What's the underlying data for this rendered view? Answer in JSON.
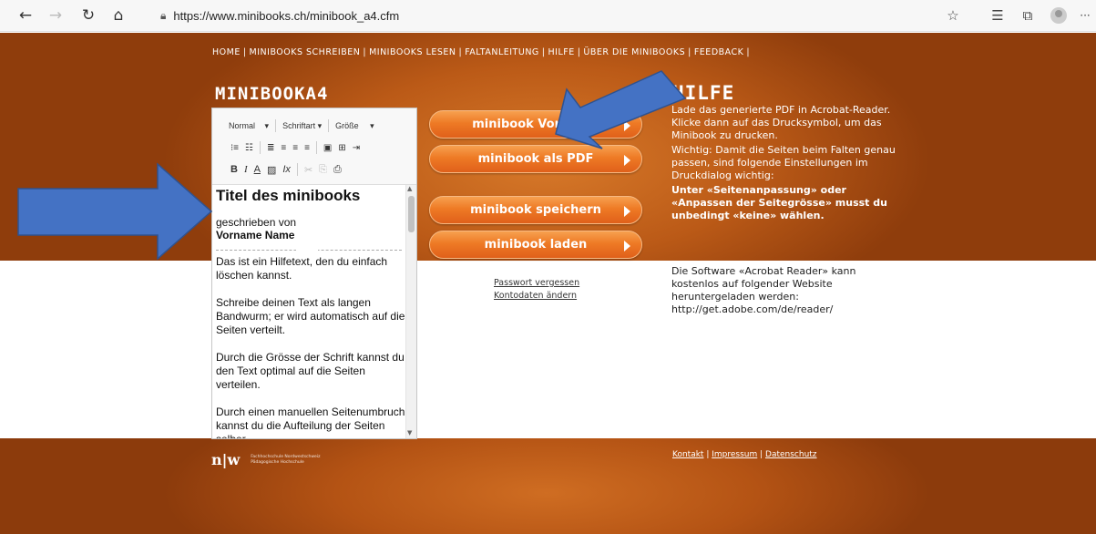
{
  "browser": {
    "url": "https://www.minibooks.ch/minibook_a4.cfm",
    "buttons": {
      "back": "←",
      "forward": "→",
      "refresh": "↻",
      "home": "⌂",
      "lock": "🔒",
      "favorite": "☆",
      "favorites": "☰",
      "collections": "⧉",
      "more": "···"
    }
  },
  "nav": {
    "items": [
      "HOME",
      "MINIBOOKS SCHREIBEN",
      "MINIBOOKS LESEN",
      "FALTANLEITUNG",
      "HILFE",
      "ÜBER DIE MINIBOOKS",
      "FEEDBACK"
    ]
  },
  "headings": {
    "minibook": "MINIBOOKA4",
    "hilfe": "HILFE"
  },
  "editor": {
    "toolbar": {
      "format": "Normal",
      "font": "Schriftart",
      "size": "Größe",
      "dropdown_caret": "▾",
      "row2": [
        "⁝≡",
        "☷",
        "≣",
        "≡",
        "≡",
        "≡",
        "▣",
        "⊞",
        "⇥"
      ],
      "row3": [
        "B",
        "I",
        "A",
        "▨",
        "Ix",
        "✂",
        "⎘",
        "⎙"
      ]
    },
    "title": "Titel des minibooks",
    "written_by": "geschrieben von",
    "name": "Vorname Name",
    "paragraphs": [
      "Das ist ein Hilfetext, den du einfach löschen kannst.",
      "Schreibe deinen Text als langen Bandwurm; er wird automatisch auf die Seiten verteilt.",
      "Durch die Grösse der Schrift kannst du den Text optimal auf die Seiten verteilen.",
      "Durch einen manuellen Seitenumbruch kannst du die Aufteilung der Seiten selber"
    ]
  },
  "buttons": {
    "preview": "minibook Vorschau",
    "pdf": "minibook als PDF",
    "save": "minibook speichern",
    "load": "minibook laden"
  },
  "help": {
    "p1": "Lade das generierte PDF in Acrobat-Reader. Klicke dann auf das Drucksymbol, um das Minibook zu drucken.",
    "p2": "Wichtig: Damit die Seiten beim Falten genau passen, sind folgende Einstellungen im Druckdialog wichtig:",
    "p3": "Unter «Seitenanpassung» oder «Anpassen der Seitegrösse» musst du unbedingt «keine» wählen."
  },
  "account": {
    "forgot": "Passwort vergessen",
    "change": "Kontodaten ändern"
  },
  "acrobat": "Die Software «Acrobat Reader» kann kostenlos auf folgender Website heruntergeladen werden: http://get.adobe.com/de/reader/",
  "footer": {
    "logo": "n|w",
    "logo_sub1": "Fachhochschule Nordwestschweiz",
    "logo_sub2": "Pädagogische Hochschule",
    "kontakt": "Kontakt",
    "impressum": "Impressum",
    "datenschutz": "Datenschutz"
  },
  "colors": {
    "annotation_arrow": "#4472c4",
    "brand_orange": "#bb5a17",
    "button_orange": "#ee7a25"
  }
}
